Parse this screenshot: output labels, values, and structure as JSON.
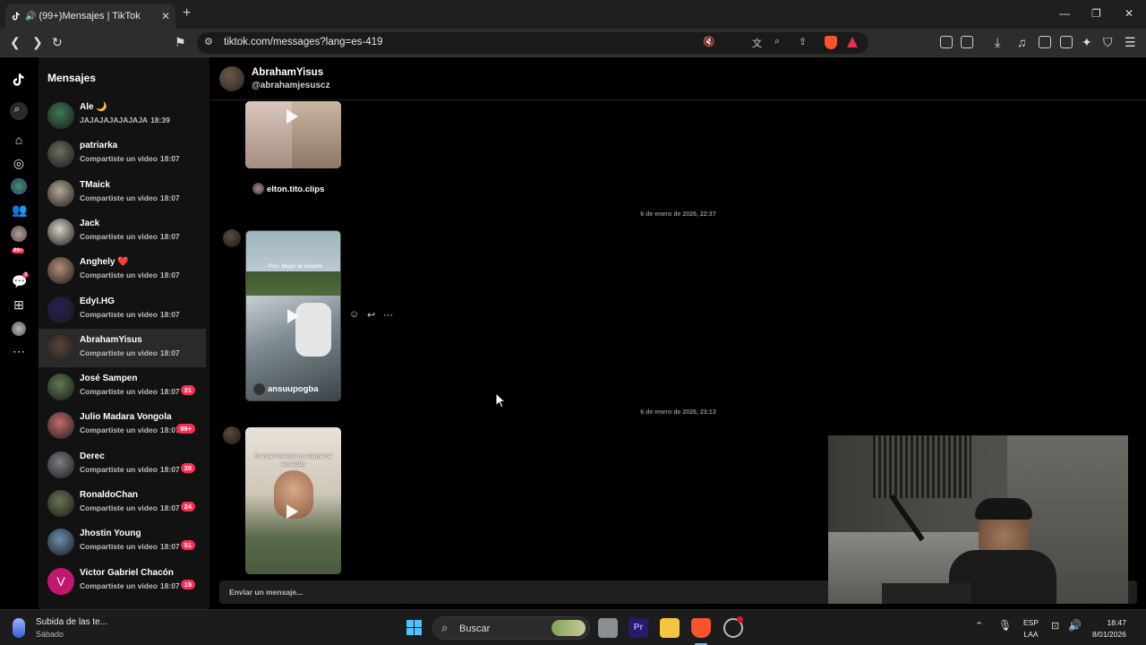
{
  "browser": {
    "tab_title": "(99+)Mensajes | TikTok",
    "url": "tiktok.com/messages?lang=es-419"
  },
  "conversations": {
    "title": "Mensajes",
    "items": [
      {
        "name": "Ale 🌙",
        "preview": "JAJAJAJAJAJAJA",
        "time": "18:39",
        "badge": ""
      },
      {
        "name": "patriarka",
        "preview": "Compartiste un video",
        "time": "18:07",
        "badge": ""
      },
      {
        "name": "TMaick",
        "preview": "Compartiste un video",
        "time": "18:07",
        "badge": ""
      },
      {
        "name": "Jack",
        "preview": "Compartiste un video",
        "time": "18:07",
        "badge": ""
      },
      {
        "name": "Anghely ❤️",
        "preview": "Compartiste un video",
        "time": "18:07",
        "badge": ""
      },
      {
        "name": "EdyI.HG",
        "preview": "Compartiste un video",
        "time": "18:07",
        "badge": ""
      },
      {
        "name": "AbrahamYisus",
        "preview": "Compartiste un video",
        "time": "18:07",
        "badge": ""
      },
      {
        "name": "José Sampen",
        "preview": "Compartiste un video",
        "time": "18:07",
        "badge": "21"
      },
      {
        "name": "Julio Madara Vongola",
        "preview": "Compartiste un video",
        "time": "18:07",
        "badge": "99+"
      },
      {
        "name": "Derec",
        "preview": "Compartiste un video",
        "time": "18:07",
        "badge": "20"
      },
      {
        "name": "RonaldoChan",
        "preview": "Compartiste un video",
        "time": "18:07",
        "badge": "24"
      },
      {
        "name": "Jhostin Young",
        "preview": "Compartiste un video",
        "time": "18:07",
        "badge": "51"
      },
      {
        "name": "Victor Gabriel Chacón",
        "preview": "Compartiste un video",
        "time": "18:07",
        "badge": "15"
      }
    ]
  },
  "chat": {
    "name": "AbrahamYisus",
    "handle": "@abrahamjesuscz",
    "messages": [
      {
        "author": "elton.tito.clips"
      },
      {
        "date": "6 de enero de 2026, 22:37",
        "author": "ansuupogba",
        "overlay": "Pov: Mujer al volante"
      },
      {
        "date": "6 de enero de 2026, 23:13",
        "overlay": "Si está teniendo un ataque de ansiedad"
      }
    ],
    "input_placeholder": "Enviar un mensaje..."
  },
  "rail": {
    "badges": {
      "inbox": "99+",
      "messages": "3"
    }
  },
  "taskbar": {
    "notif_title": "Subida de las te...",
    "notif_sub": "Sábado",
    "search": "Buscar",
    "lang_top": "ESP",
    "lang_bottom": "LAA",
    "time": "18:47",
    "date": "8/01/2026"
  },
  "colors": {
    "accent": "#fe2c55",
    "bg": "#000000",
    "panel": "#121212"
  }
}
